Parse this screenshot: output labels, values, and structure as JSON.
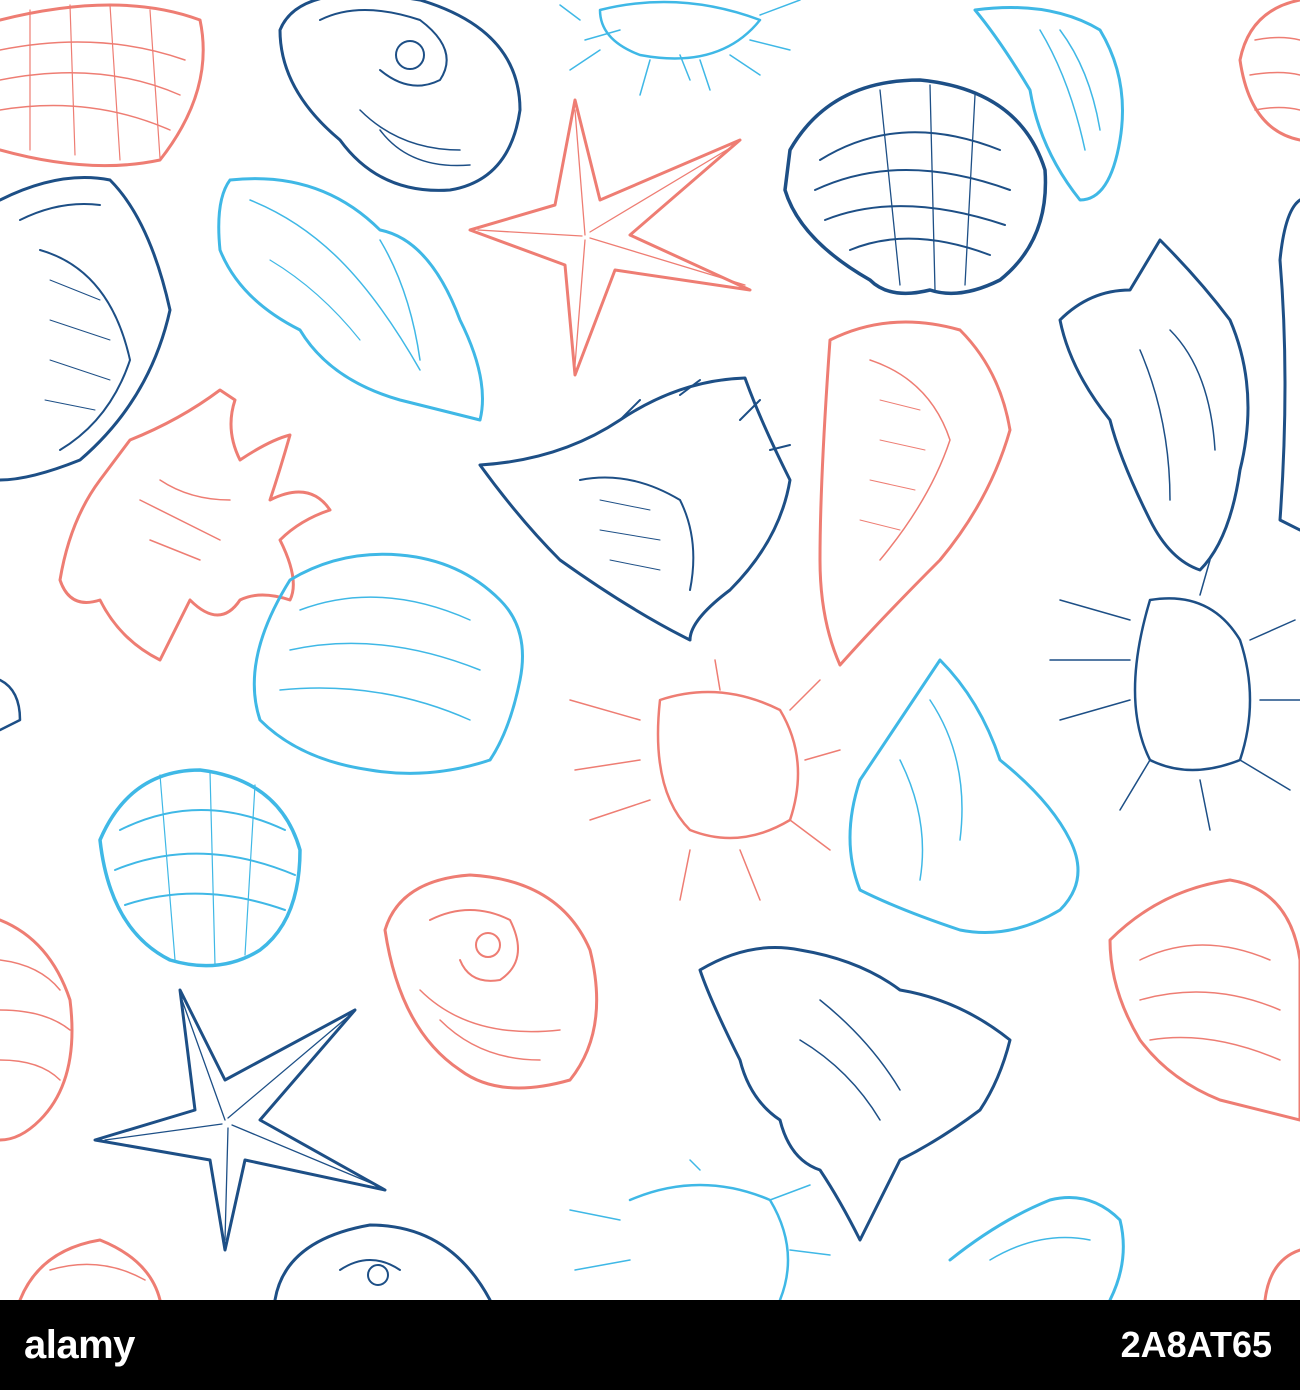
{
  "image": {
    "description_kind": "seamless seashell pattern",
    "colors": {
      "coral": "#ee7d73",
      "navy": "#1d4f86",
      "sky": "#3fb8e6",
      "background": "#ffffff",
      "footer": "#000000"
    },
    "motifs": [
      {
        "kind": "scallop",
        "color": "coral"
      },
      {
        "kind": "nautilus",
        "color": "navy"
      },
      {
        "kind": "urchin",
        "color": "sky"
      },
      {
        "kind": "conch",
        "color": "sky"
      },
      {
        "kind": "scallop",
        "color": "navy"
      },
      {
        "kind": "starfish",
        "color": "coral"
      },
      {
        "kind": "spider-conch",
        "color": "coral"
      },
      {
        "kind": "murex",
        "color": "navy"
      },
      {
        "kind": "whelk",
        "color": "coral"
      },
      {
        "kind": "nautilus",
        "color": "coral"
      },
      {
        "kind": "urchin",
        "color": "coral"
      },
      {
        "kind": "urchin",
        "color": "navy"
      },
      {
        "kind": "starfish",
        "color": "navy"
      },
      {
        "kind": "spider-conch",
        "color": "navy"
      }
    ]
  },
  "footer": {
    "logo": "alamy",
    "image_id": "2A8AT65"
  }
}
